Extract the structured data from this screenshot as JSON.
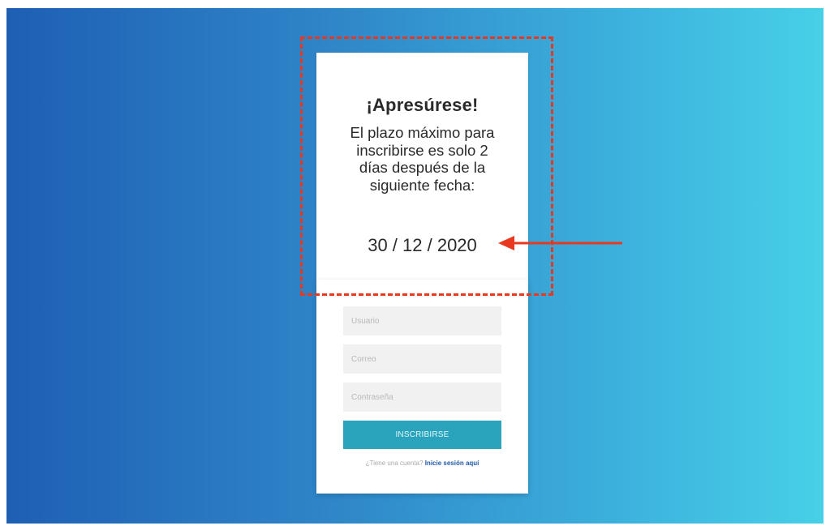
{
  "deadline_card": {
    "title": "¡Apresúrese!",
    "message": "El plazo máximo para inscribirse es solo 2 días después de la siguiente fecha:",
    "date": "30 / 12 / 2020"
  },
  "signup_form": {
    "username_placeholder": "Usuario",
    "email_placeholder": "Correo",
    "password_placeholder": "Contraseña",
    "submit_label": "INSCRIBIRSE",
    "login_prompt": "¿Tiene una cuenta?",
    "login_link": "Inicie sesión aquí"
  },
  "annotation": {
    "color": "#e8381f",
    "icon": "arrow-left-icon"
  },
  "colors": {
    "gradient_start": "#1e5fb4",
    "gradient_end": "#47d0e7",
    "button": "#2aa3bd",
    "link": "#1d5aa8"
  }
}
